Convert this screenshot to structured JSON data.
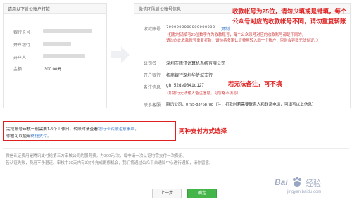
{
  "left": {
    "header": "请用以下对公账户打款",
    "bank_card_label": "银行卡号",
    "bank_label": "开户银行",
    "account_holder_label": "开户人",
    "amount_label": "金额",
    "amount_value": "300.00元"
  },
  "right": {
    "header": "微信团队对公账号信息",
    "receive_account_label": "收款账号",
    "receive_account_value": "7999999999999999999",
    "copy_link": "复制",
    "receive_account_note_1": "（打款时请填写25位数字作为收款账号，每个公众账号对应的收款账号都是不同的，",
    "receive_account_note_2": "请勿向此收款账号重复打款，请勿将多笔认证费用转入同一个账户，否则会导致无法认证。）",
    "company_label": "公司名",
    "company_value": "深圳市腾讯计算机系统有限公司",
    "bank_label": "开户银行",
    "bank_value": "招商银行深圳华侨城支行",
    "remark_label": "备注信息",
    "remark_value": "gh_52de9841c127",
    "remark_note": "（如银行无法输入备注信息，可忽略不填写）",
    "contact_label": "联系客服",
    "contact_value": "腾讯公司，0755-83768788（注：打款时若需要联系人和联系电话，可填写以上信息）"
  },
  "annotations": {
    "top_red_1": "收款帐号为25位，请勿少填或是错填，每个",
    "top_red_2": "公众号对应的收款帐号不同，请勿重复转账",
    "remark_red": "若无法备注，可不填",
    "payment_red": "两种支付方式选择"
  },
  "notice": {
    "line1_prefix": "完成账号审核一般需要1-5个工作日，转账时请查看",
    "line1_link": "银行卡转账注意事项",
    "line1_suffix": "。",
    "line2_prefix": "你也可以使用",
    "line2_link": "微信支付",
    "line2_suffix": "。"
  },
  "footer": {
    "line1": "微信认证费用是腾讯支付给第三方审核公司的服务费，为300元/次，每申请一次认证均需支付一次费用。",
    "line2": "若认证失败，费用不予退还。审核中30天内有3次补充或更修机会，我们将通过公众平台通知中心进行通知，请你留意。"
  },
  "buttons": {
    "prev": "上一步",
    "confirm": "确定"
  },
  "watermark": {
    "brand": "Bai",
    "suffix": "经验",
    "url": "jingyan.baidu.com"
  },
  "colors": {
    "red": "#e02020",
    "green_button": "#44b549",
    "link_blue": "#3e7ccf",
    "red_box": "#e02020"
  }
}
